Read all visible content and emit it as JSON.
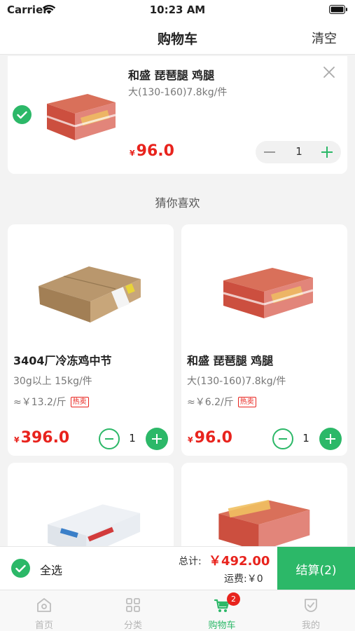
{
  "status_bar": {
    "carrier": "Carrier",
    "time": "10:23 AM"
  },
  "nav": {
    "title": "购物车",
    "clear_label": "清空"
  },
  "cart_items": [
    {
      "name": "和盛 琵琶腿 鸡腿",
      "spec": "大(130-160)7.8kg/件",
      "currency": "¥",
      "price": "96.0",
      "quantity": "1",
      "selected": true
    }
  ],
  "recommend": {
    "title": "猜你喜欢",
    "items": [
      {
        "name": "3404厂冷冻鸡中节",
        "spec": "30g以上 15kg/件",
        "ref_price": "≈￥13.2/斤",
        "tag": "热卖",
        "currency": "¥",
        "price": "396.0",
        "quantity": "1"
      },
      {
        "name": "和盛 琵琶腿 鸡腿",
        "spec": "大(130-160)7.8kg/件",
        "ref_price": "≈￥6.2/斤",
        "tag": "热卖",
        "currency": "¥",
        "price": "96.0",
        "quantity": "1"
      }
    ]
  },
  "checkout": {
    "select_all_label": "全选",
    "total_label": "总计:",
    "total_value": "￥492.00",
    "shipping": "运费:￥0",
    "checkout_label": "结算(2)"
  },
  "tabs": [
    {
      "label": "首页",
      "icon": "home-icon"
    },
    {
      "label": "分类",
      "icon": "grid-icon"
    },
    {
      "label": "购物车",
      "icon": "cart-icon",
      "badge": "2",
      "active": true
    },
    {
      "label": "我的",
      "icon": "profile-icon"
    }
  ],
  "colors": {
    "accent": "#2cb868",
    "price": "#e8231d"
  }
}
